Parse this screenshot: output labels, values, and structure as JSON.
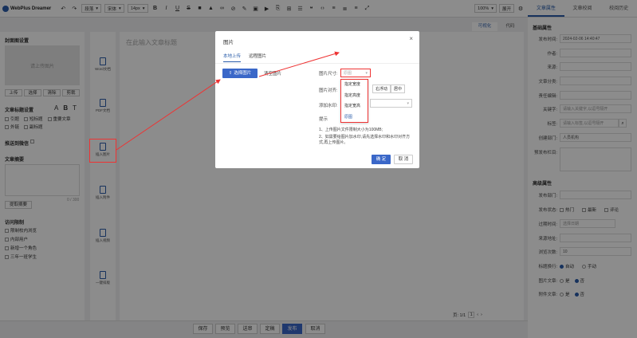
{
  "app": {
    "name": "WebPlus Dreamer"
  },
  "toolbar": {
    "style_select": "段落",
    "font_select": "宋体",
    "size_select": "14px",
    "zoom": "100%",
    "expand": "展开"
  },
  "right_tabs": [
    "文章属性",
    "文章校阅",
    "校阅历史"
  ],
  "editor_tabs": [
    "可视化",
    "代码"
  ],
  "editor": {
    "title_placeholder": "在此输入文章标题"
  },
  "left": {
    "cover_title": "封面图设置",
    "cover_placeholder": "请上传图片",
    "cover_buttons": [
      "上传",
      "选择",
      "清除",
      "剪裁"
    ],
    "title_settings": "文章标题设置",
    "title_formats": [
      "A",
      "B",
      "T"
    ],
    "title_options": [
      "引题",
      "短标题",
      "重要文章",
      "外链",
      "副标题"
    ],
    "wechat": "推送到微信",
    "summary": "文章摘要",
    "summary_count": "0 / 300",
    "extract": "提取摘要",
    "access": "访问限制",
    "access_options": [
      "限制校内浏览",
      "内部用户",
      "新增一个角色",
      "三年一班学生"
    ]
  },
  "strip": [
    "Word文档",
    "PDF文档",
    "插入图片",
    "插入附件",
    "插入视频",
    "一键排版"
  ],
  "pager": {
    "label": "页: 1/1",
    "value": "1"
  },
  "bottom_buttons": [
    "保存",
    "预览",
    "送审",
    "定稿",
    "发布",
    "取消"
  ],
  "props": {
    "basic": "基础属性",
    "publish_time_label": "发布时间:",
    "publish_time": "2024-02-06 14:40:47",
    "author": "作者:",
    "source": "来源:",
    "category": "文章分类:",
    "editor": "责任编辑:",
    "keywords": "关键字:",
    "keywords_ph": "请输入关键字,以逗号隔开",
    "tags": "标签:",
    "tags_ph": "请输入标签,以逗号隔开",
    "creator_dept": "创建部门:",
    "creator_dept_val": "人员机构",
    "preset_column": "预发布栏目:",
    "advanced": "高级属性",
    "publish_dept": "发布部门:",
    "publish_state": "发布状态:",
    "state_opts": [
      "热门",
      "最新",
      "评论"
    ],
    "expire": "过期时间:",
    "expire_ph": "选择日期",
    "source_url": "来源地址:",
    "views": "浏览次数:",
    "views_val": "10",
    "title_wrap": "标题换行:",
    "wrap_opts": [
      "自动",
      "手动"
    ],
    "img_article": "图片文章:",
    "attach_article": "附件文章:",
    "yes_no": [
      "是",
      "否"
    ]
  },
  "dialog": {
    "title": "图片",
    "tabs": [
      "本地上传",
      "远程图片"
    ],
    "choose": "选择图片",
    "clear": "清空图片",
    "size_label": "图片尺寸:",
    "size_value": "原图",
    "size_options": [
      "指定宽度",
      "指定高度",
      "指定宽高",
      "原图"
    ],
    "align_label": "图片对齐:",
    "align_right": "右浮动",
    "align_center": "居中",
    "watermark_label": "添加水印:",
    "tips_title": "提示",
    "tip1": "1、上传图片文件限制大小为100MB;",
    "tip2": "2、如需要给图片加水印,请先选择水印和水印对齐方式,再上传图片。",
    "ok": "确 定",
    "cancel": "取 消"
  }
}
